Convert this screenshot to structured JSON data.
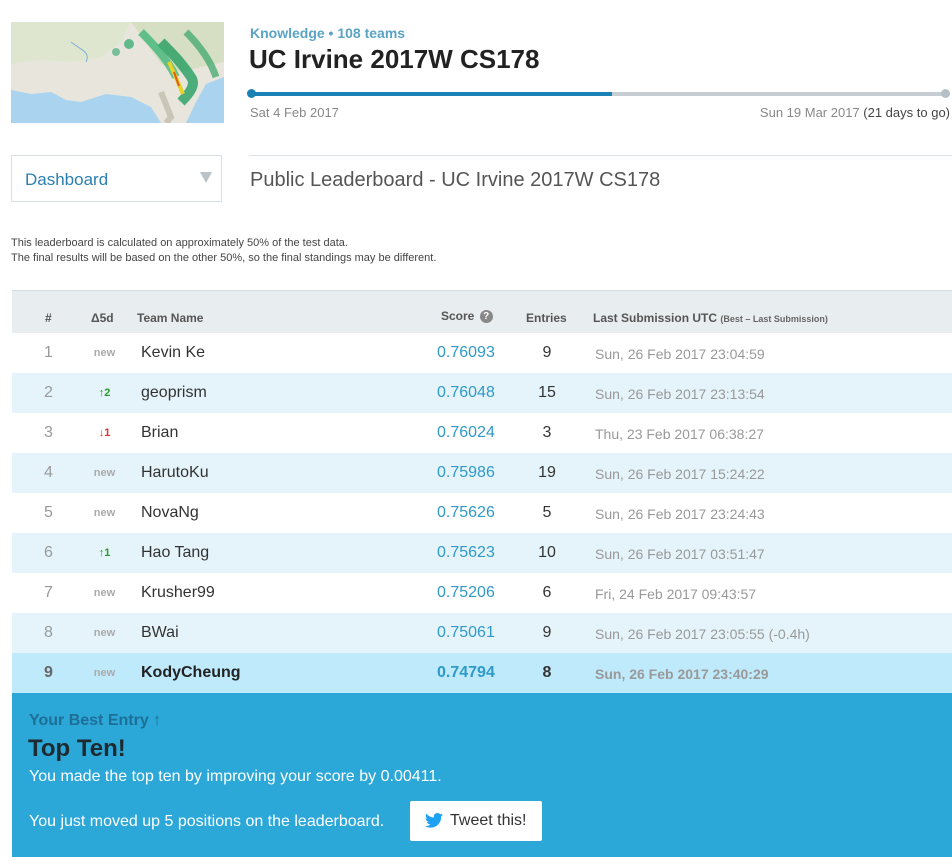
{
  "competition": {
    "meta": "Knowledge • 108 teams",
    "title": "UC Irvine 2017W CS178",
    "progress": 0.52,
    "start_date": "Sat 4 Feb 2017",
    "end_date": "Sun 19 Mar 2017",
    "days_left": "(21 days to go)"
  },
  "nav": {
    "dropdown_label": "Dashboard",
    "leaderboard_title": "Public Leaderboard - UC Irvine 2017W CS178"
  },
  "notice": {
    "line1": "This leaderboard is calculated on approximately 50% of the test data.",
    "line2": "The final results will be based on the other 50%, so the final standings may be different."
  },
  "table": {
    "headers": {
      "rank": "#",
      "delta": "Δ5d",
      "team": "Team Name",
      "score": "Score",
      "score_help": "?",
      "entries": "Entries",
      "last_submission": "Last Submission UTC",
      "last_submission_note": "(Best – Last Submission)"
    },
    "rows": [
      {
        "rank": "1",
        "delta": "new",
        "delta_type": "new",
        "team": "Kevin Ke",
        "score": "0.76093",
        "entries": "9",
        "time": "Sun, 26 Feb 2017 23:04:59"
      },
      {
        "rank": "2",
        "delta": "↑2",
        "delta_type": "up",
        "team": "geoprism",
        "score": "0.76048",
        "entries": "15",
        "time": "Sun, 26 Feb 2017 23:13:54"
      },
      {
        "rank": "3",
        "delta": "↓1",
        "delta_type": "down",
        "team": "Brian",
        "score": "0.76024",
        "entries": "3",
        "time": "Thu, 23 Feb 2017 06:38:27"
      },
      {
        "rank": "4",
        "delta": "new",
        "delta_type": "new",
        "team": "HarutoKu",
        "score": "0.75986",
        "entries": "19",
        "time": "Sun, 26 Feb 2017 15:24:22"
      },
      {
        "rank": "5",
        "delta": "new",
        "delta_type": "new",
        "team": "NovaNg",
        "score": "0.75626",
        "entries": "5",
        "time": "Sun, 26 Feb 2017 23:24:43"
      },
      {
        "rank": "6",
        "delta": "↑1",
        "delta_type": "up",
        "team": "Hao Tang",
        "score": "0.75623",
        "entries": "10",
        "time": "Sun, 26 Feb 2017 03:51:47"
      },
      {
        "rank": "7",
        "delta": "new",
        "delta_type": "new",
        "team": "Krusher99",
        "score": "0.75206",
        "entries": "6",
        "time": "Fri, 24 Feb 2017 09:43:57"
      },
      {
        "rank": "8",
        "delta": "new",
        "delta_type": "new",
        "team": "BWai",
        "score": "0.75061",
        "entries": "9",
        "time": "Sun, 26 Feb 2017 23:05:55 (-0.4h)"
      },
      {
        "rank": "9",
        "delta": "new",
        "delta_type": "new",
        "team": "KodyCheung",
        "score": "0.74794",
        "entries": "8",
        "time": "Sun, 26 Feb 2017 23:40:29",
        "is_me": true
      }
    ]
  },
  "best_entry": {
    "label": "Your Best Entry ↑",
    "headline": "Top Ten!",
    "message1": "You made the top ten by improving your score by 0.00411.",
    "message2": "You just moved up 5 positions on the leaderboard.",
    "tweet_label": "Tweet this!"
  },
  "colors": {
    "accent": "#1a82b4",
    "panel": "#2ba7d8",
    "row_alt": "#e5f4fa",
    "row_me": "#bfeafb"
  }
}
